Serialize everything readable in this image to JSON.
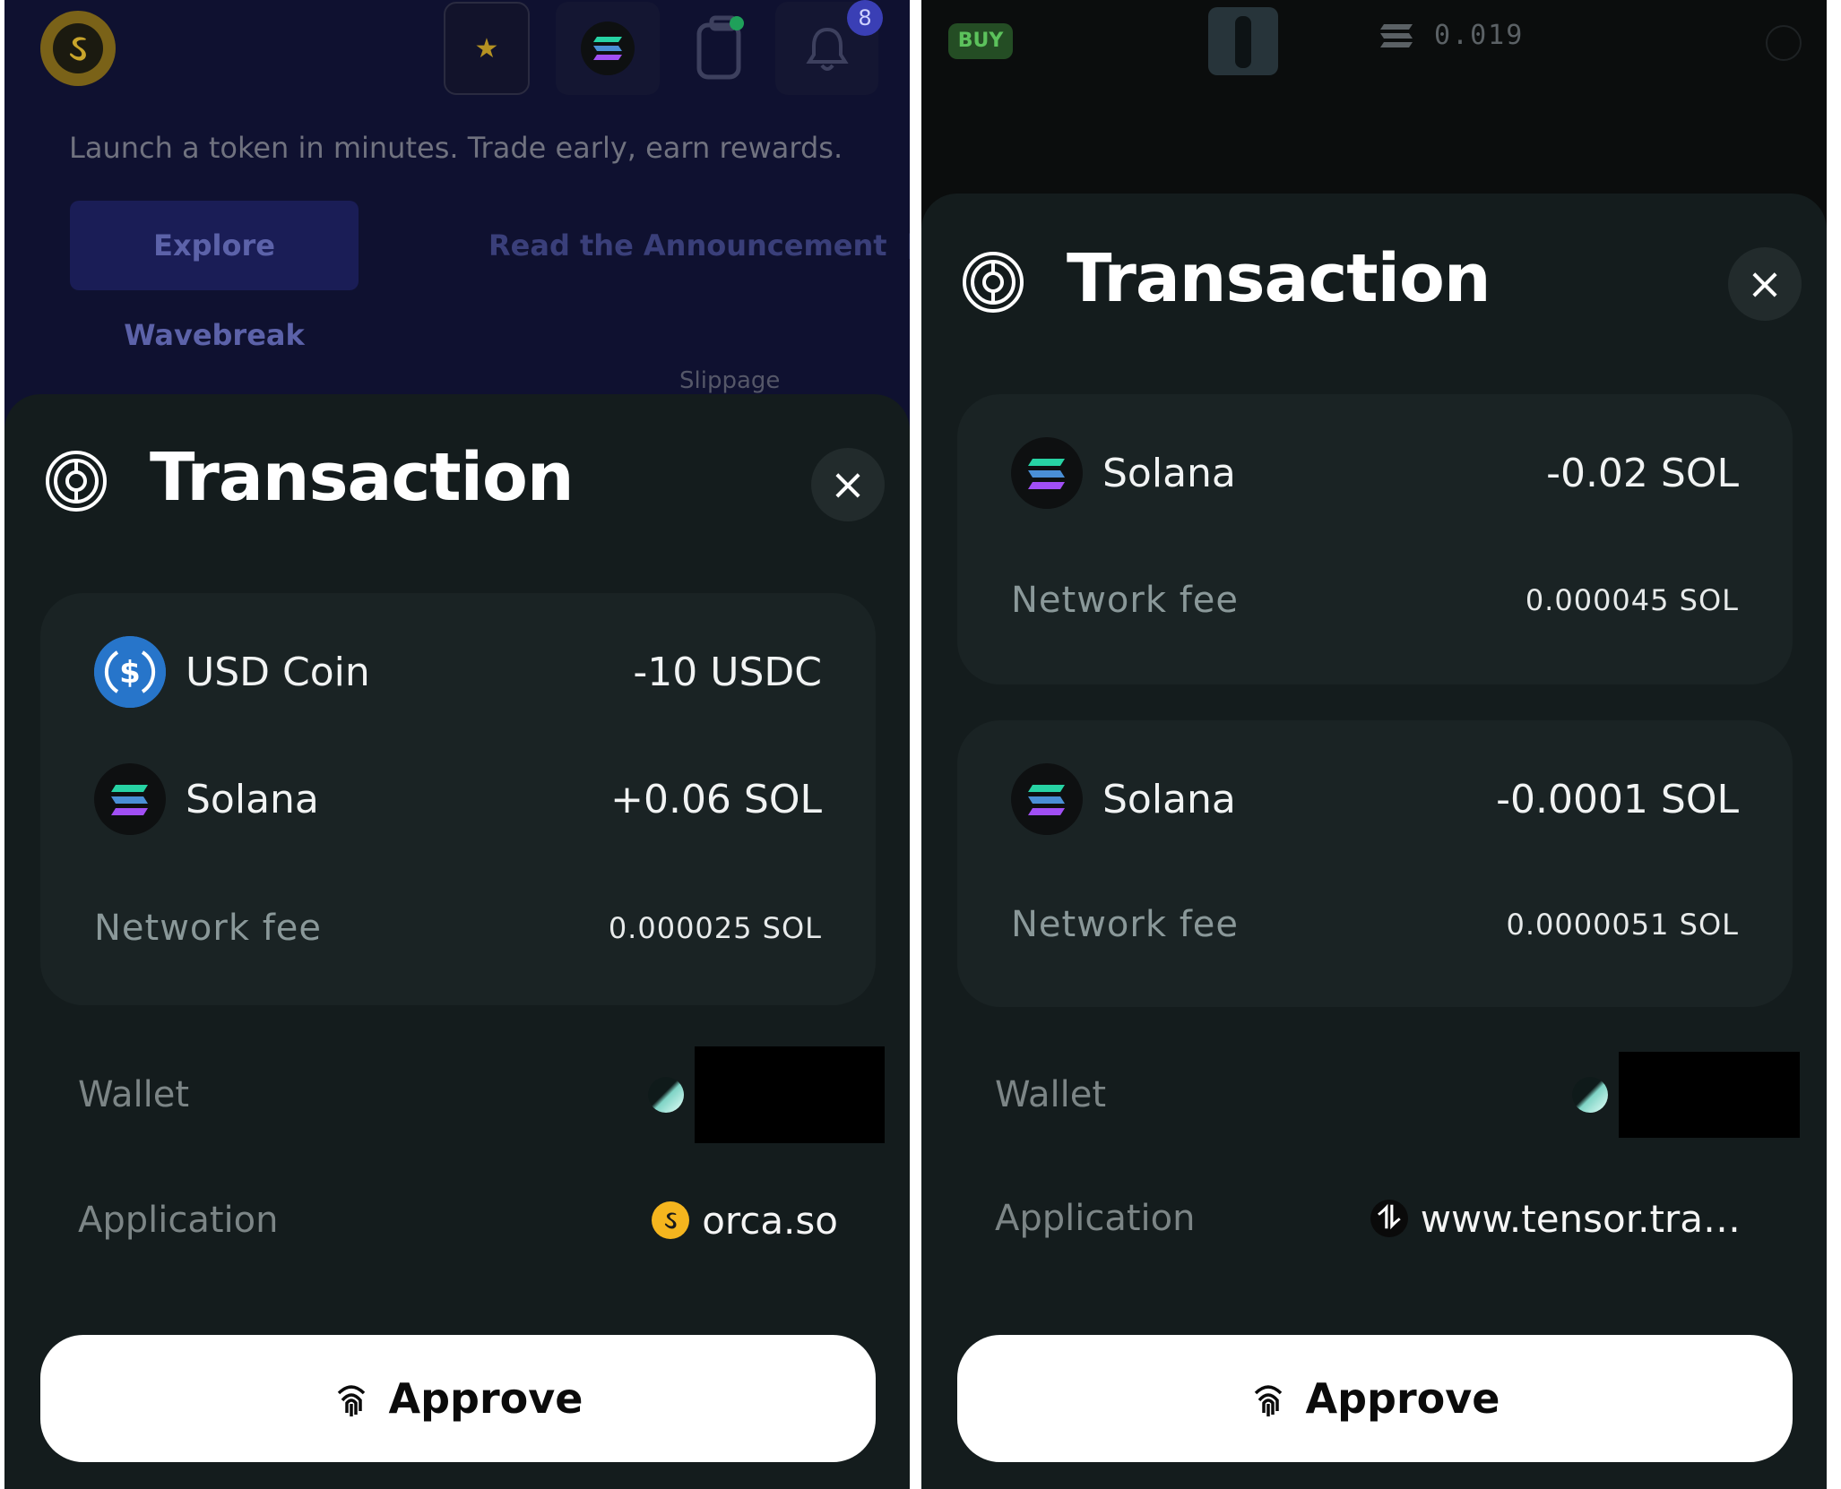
{
  "left": {
    "background": {
      "tagline": "Launch a token in minutes. Trade early, earn rewards.",
      "explore_button": "Explore Wavebreak",
      "read_link": "Read the Announcement",
      "slippage_label": "Slippage",
      "notification_count": "8"
    },
    "sheet": {
      "title": "Transaction",
      "close_label": "×",
      "card": {
        "rows": [
          {
            "token": "USD Coin",
            "amount": "-10 USDC",
            "icon": "usdc-icon"
          },
          {
            "token": "Solana",
            "amount": "+0.06 SOL",
            "icon": "solana-icon"
          }
        ],
        "fee_label": "Network fee",
        "fee_value": "0.000025 SOL"
      },
      "wallet_label": "Wallet",
      "application_label": "Application",
      "application_value": "orca.so",
      "approve_label": "Approve"
    }
  },
  "right": {
    "background": {
      "buy_badge": "BUY",
      "price": "0.019"
    },
    "sheet": {
      "title": "Transaction",
      "close_label": "×",
      "cards": [
        {
          "token": "Solana",
          "amount": "-0.02 SOL",
          "fee_label": "Network fee",
          "fee_value": "0.000045 SOL"
        },
        {
          "token": "Solana",
          "amount": "-0.0001 SOL",
          "fee_label": "Network fee",
          "fee_value": "0.0000051 SOL"
        }
      ],
      "wallet_label": "Wallet",
      "application_label": "Application",
      "application_value": "www.tensor.tra…",
      "approve_label": "Approve"
    }
  },
  "colors": {
    "left_background": "#0f1130",
    "right_background": "#0b0d0d",
    "sheet": "#141c1d",
    "card": "#1a2324",
    "approve_button": "#ffffff",
    "usdc_blue": "#2775ca",
    "buy_green": "#5cc25c"
  }
}
